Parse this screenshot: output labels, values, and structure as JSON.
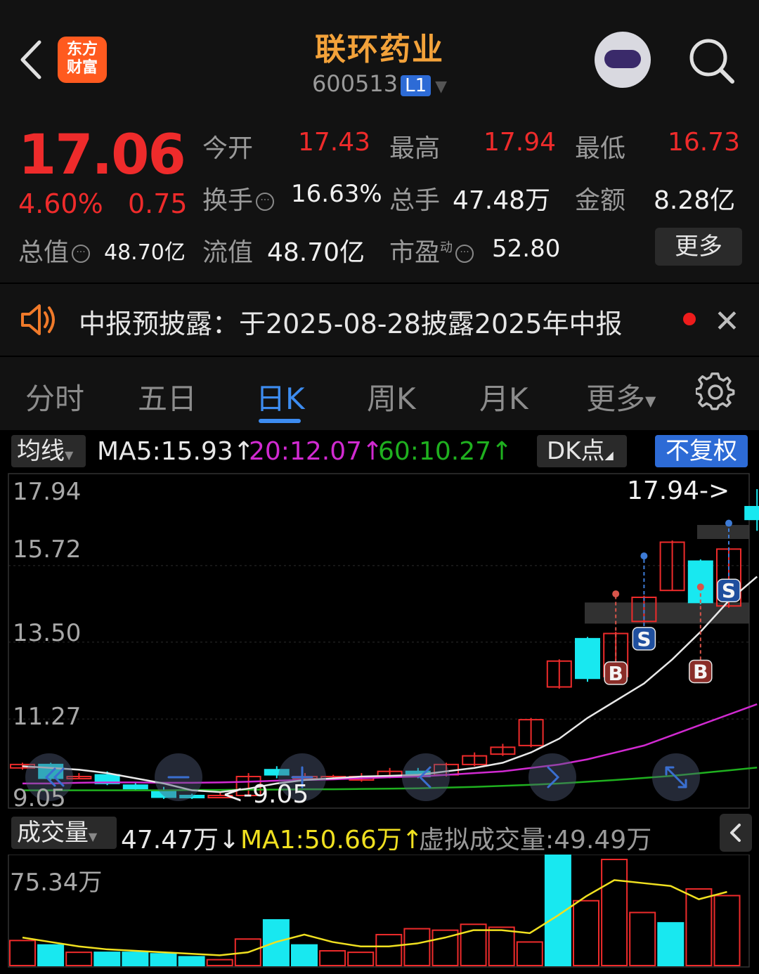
{
  "header": {
    "logo_text": "东方财富",
    "stock_name": "联环药业",
    "stock_code": "600513",
    "level_badge": "L1",
    "icons": [
      "back-icon",
      "search-icon",
      "avatar-icon"
    ]
  },
  "quote": {
    "price": "17.06",
    "change_pct": "4.60%",
    "change": "0.75",
    "open_label": "今开",
    "open": "17.43",
    "high_label": "最高",
    "high": "17.94",
    "low_label": "最低",
    "low": "16.73",
    "turnover_label": "换手",
    "turnover": "16.63%",
    "volume_label": "总手",
    "volume": "47.48万",
    "amount_label": "金额",
    "amount": "8.28亿",
    "mktcap_label": "总值",
    "mktcap": "48.70亿",
    "float_label": "流值",
    "float_cap": "48.70亿",
    "pe_label": "市盈",
    "pe_sup": "动",
    "pe": "52.80",
    "more_button": "更多",
    "up_color": "#ee2b2b"
  },
  "notice": {
    "text": "中报预披露：于2025-08-28披露2025年中报"
  },
  "tabs": {
    "items": [
      "分时",
      "五日",
      "日K",
      "周K",
      "月K",
      "更多"
    ],
    "active": "日K"
  },
  "ma_bar": {
    "selector": "均线",
    "ma5": "MA5:15.93↑",
    "ma20": "20:12.07↑",
    "ma60": "60:10.27↑",
    "dk_button": "DK点",
    "adjust_button": "不复权",
    "ma5_color": "#e8e8e8",
    "ma20_color": "#d12ad1",
    "ma60_color": "#1fb01f"
  },
  "price_chart": {
    "y_labels": [
      "17.94",
      "15.72",
      "13.50",
      "11.27",
      "9.05"
    ],
    "high_marker": "17.94->",
    "low_marker": "<-9.05",
    "signal_labels": [
      "B",
      "S",
      "B",
      "S"
    ]
  },
  "volume_bar": {
    "selector": "成交量",
    "volume": "47.47万↓",
    "ma1": "MA1:50.66万↑",
    "virtual": "虚拟成交量:49.49万",
    "max_label": "75.34万"
  },
  "chart_data": {
    "type": "bar",
    "title": "",
    "xlabel": "",
    "ylabel": "",
    "ylim": [
      9.05,
      17.94
    ],
    "candles": [
      {
        "o": 9.85,
        "c": 9.95,
        "h": 10.0,
        "l": 9.8
      },
      {
        "o": 9.95,
        "c": 9.55,
        "h": 10.0,
        "l": 9.5
      },
      {
        "o": 9.6,
        "c": 9.6,
        "h": 9.7,
        "l": 9.55
      },
      {
        "o": 9.65,
        "c": 9.4,
        "h": 9.75,
        "l": 9.35
      },
      {
        "o": 9.35,
        "c": 9.25,
        "h": 9.45,
        "l": 9.2
      },
      {
        "o": 9.2,
        "c": 9.0,
        "h": 9.3,
        "l": 8.95
      },
      {
        "o": 9.05,
        "c": 9.0,
        "h": 9.1,
        "l": 8.95
      },
      {
        "o": 9.05,
        "c": 9.05,
        "h": 9.15,
        "l": 9.05
      },
      {
        "o": 9.05,
        "c": 9.6,
        "h": 9.7,
        "l": 9.05
      },
      {
        "o": 9.8,
        "c": 9.65,
        "h": 9.9,
        "l": 9.55
      },
      {
        "o": 9.6,
        "c": 9.6,
        "h": 9.7,
        "l": 9.5
      },
      {
        "o": 9.6,
        "c": 9.6,
        "h": 9.65,
        "l": 9.5
      },
      {
        "o": 9.5,
        "c": 9.6,
        "h": 9.7,
        "l": 9.45
      },
      {
        "o": 9.6,
        "c": 9.75,
        "h": 9.85,
        "l": 9.55
      },
      {
        "o": 9.75,
        "c": 9.6,
        "h": 9.85,
        "l": 9.55
      },
      {
        "o": 9.65,
        "c": 9.95,
        "h": 10.0,
        "l": 9.6
      },
      {
        "o": 9.95,
        "c": 10.2,
        "h": 10.3,
        "l": 9.9
      },
      {
        "o": 10.25,
        "c": 10.45,
        "h": 10.55,
        "l": 10.2
      },
      {
        "o": 10.5,
        "c": 11.25,
        "h": 11.3,
        "l": 10.45
      },
      {
        "o": 12.2,
        "c": 12.95,
        "h": 13.0,
        "l": 12.15
      },
      {
        "o": 13.6,
        "c": 12.45,
        "h": 13.65,
        "l": 12.35
      },
      {
        "o": 12.5,
        "c": 13.75,
        "h": 13.8,
        "l": 12.45
      },
      {
        "o": 14.1,
        "c": 14.8,
        "h": 14.85,
        "l": 14.05
      },
      {
        "o": 15.0,
        "c": 16.4,
        "h": 16.45,
        "l": 15.0
      },
      {
        "o": 15.85,
        "c": 14.65,
        "h": 15.9,
        "l": 14.6
      },
      {
        "o": 14.55,
        "c": 16.2,
        "h": 16.25,
        "l": 14.5
      },
      {
        "o": 17.43,
        "c": 17.06,
        "h": 17.94,
        "l": 16.73
      }
    ],
    "ma5": [
      9.9,
      9.85,
      9.8,
      9.7,
      9.55,
      9.4,
      9.2,
      9.15,
      9.25,
      9.4,
      9.5,
      9.55,
      9.6,
      9.62,
      9.65,
      9.75,
      9.85,
      10.0,
      10.3,
      10.7,
      11.3,
      11.8,
      12.3,
      13.0,
      13.8,
      14.7,
      15.4
    ],
    "ma20": [
      9.4,
      9.4,
      9.42,
      9.43,
      9.43,
      9.42,
      9.42,
      9.43,
      9.45,
      9.48,
      9.5,
      9.52,
      9.55,
      9.58,
      9.6,
      9.65,
      9.7,
      9.75,
      9.85,
      9.95,
      10.1,
      10.3,
      10.5,
      10.8,
      11.1,
      11.4,
      11.7
    ],
    "ma60": [
      9.2,
      9.2,
      9.2,
      9.2,
      9.2,
      9.2,
      9.21,
      9.21,
      9.22,
      9.22,
      9.23,
      9.23,
      9.24,
      9.25,
      9.26,
      9.28,
      9.3,
      9.33,
      9.36,
      9.4,
      9.45,
      9.5,
      9.56,
      9.62,
      9.7,
      9.78,
      9.86
    ],
    "volume": {
      "max": 75.34,
      "bars": [
        {
          "v": 17,
          "up": true
        },
        {
          "v": 14,
          "up": false
        },
        {
          "v": 9,
          "up": true
        },
        {
          "v": 9,
          "up": false
        },
        {
          "v": 9,
          "up": false
        },
        {
          "v": 8,
          "up": false
        },
        {
          "v": 6,
          "up": false
        },
        {
          "v": 4,
          "up": true
        },
        {
          "v": 18,
          "up": true
        },
        {
          "v": 31,
          "up": false
        },
        {
          "v": 14,
          "up": false
        },
        {
          "v": 10,
          "up": true
        },
        {
          "v": 9,
          "up": true
        },
        {
          "v": 21,
          "up": true
        },
        {
          "v": 25,
          "up": true
        },
        {
          "v": 24,
          "up": true
        },
        {
          "v": 28,
          "up": true
        },
        {
          "v": 26,
          "up": true
        },
        {
          "v": 16,
          "up": true
        },
        {
          "v": 75.34,
          "up": false
        },
        {
          "v": 44,
          "up": true
        },
        {
          "v": 72,
          "up": true
        },
        {
          "v": 36,
          "up": true
        },
        {
          "v": 29,
          "up": false
        },
        {
          "v": 52,
          "up": true
        },
        {
          "v": 47.47,
          "up": true
        }
      ],
      "ma1": [
        19,
        16,
        13,
        11,
        10,
        9,
        8,
        7,
        9,
        16,
        21,
        16,
        13,
        13,
        15,
        19,
        24,
        24,
        22,
        34,
        47,
        58,
        56,
        54,
        45,
        50
      ]
    }
  }
}
